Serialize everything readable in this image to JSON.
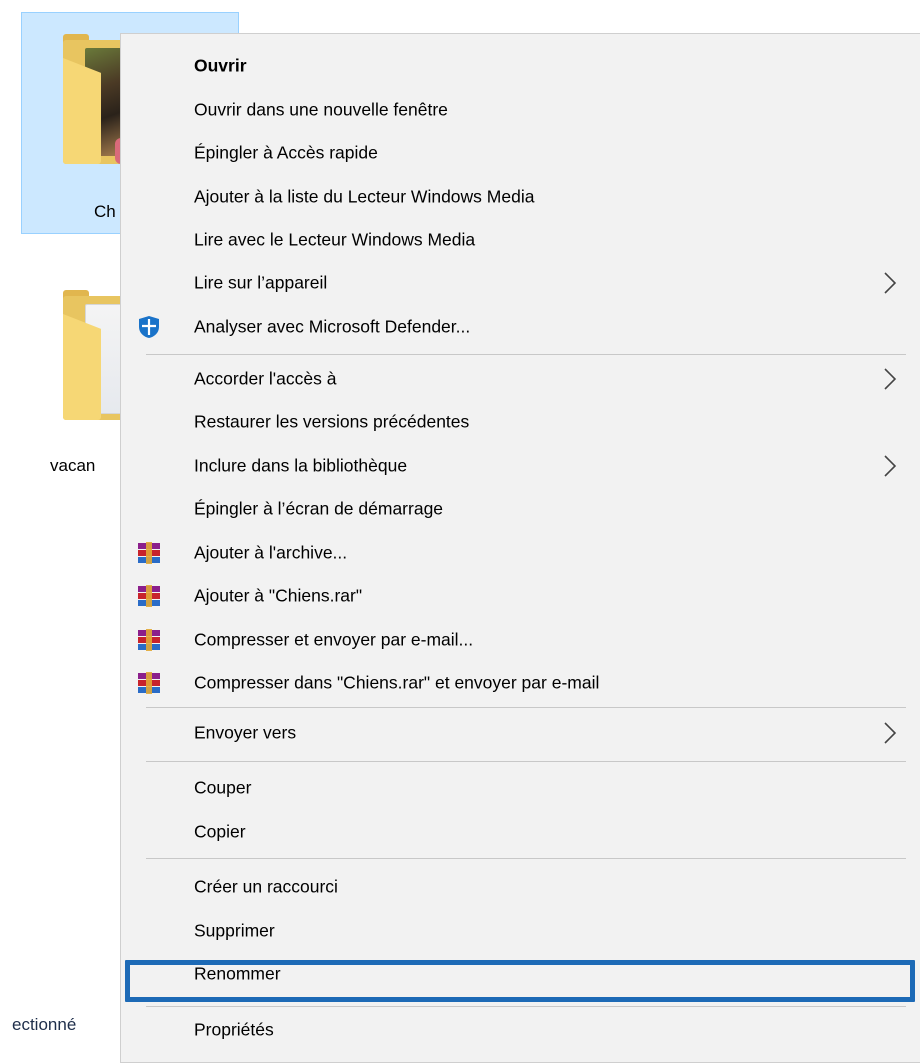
{
  "explorer": {
    "folder1_label": "Ch",
    "folder2_label": "vacan",
    "status_text": "ectionné"
  },
  "context_menu": {
    "items": [
      {
        "label": "Ouvrir",
        "bold": true
      },
      {
        "label": "Ouvrir dans une nouvelle fenêtre"
      },
      {
        "label": "Épingler à Accès rapide"
      },
      {
        "label": "Ajouter à la liste du Lecteur Windows Media"
      },
      {
        "label": "Lire avec le Lecteur Windows Media"
      },
      {
        "label": "Lire sur l’appareil",
        "submenu": true
      },
      {
        "label": "Analyser avec Microsoft Defender...",
        "icon": "defender-shield-icon"
      },
      {
        "label": "Accorder l'accès à",
        "submenu": true
      },
      {
        "label": "Restaurer les versions précédentes"
      },
      {
        "label": "Inclure dans la bibliothèque",
        "submenu": true
      },
      {
        "label": "Épingler à l’écran de démarrage"
      },
      {
        "label": "Ajouter à l'archive...",
        "icon": "winrar-icon"
      },
      {
        "label": "Ajouter à \"Chiens.rar\"",
        "icon": "winrar-icon"
      },
      {
        "label": "Compresser et envoyer par e-mail...",
        "icon": "winrar-icon"
      },
      {
        "label": "Compresser dans \"Chiens.rar\" et envoyer par e-mail",
        "icon": "winrar-icon"
      },
      {
        "label": "Envoyer vers",
        "submenu": true
      },
      {
        "label": "Couper"
      },
      {
        "label": "Copier"
      },
      {
        "label": "Créer un raccourci"
      },
      {
        "label": "Supprimer"
      },
      {
        "label": "Renommer",
        "highlighted": true
      },
      {
        "label": "Propriétés"
      }
    ]
  },
  "colors": {
    "menu_background": "#f2f2f2",
    "selection_tile": "#cce8ff",
    "highlight_border": "#1d6ab6",
    "defender_blue": "#1a73c9"
  }
}
